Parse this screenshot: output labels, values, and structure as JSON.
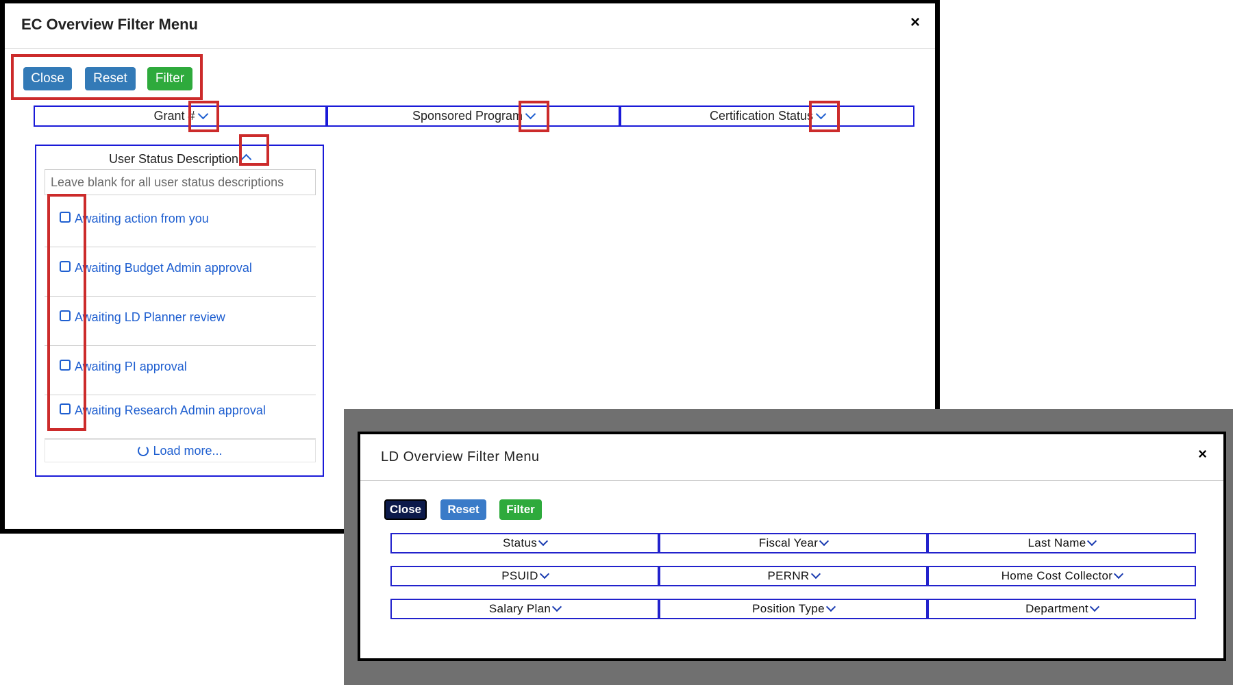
{
  "ec_dialog": {
    "title": "EC Overview Filter Menu",
    "close_x": "×",
    "buttons": {
      "close": "Close",
      "reset": "Reset",
      "filter": "Filter"
    },
    "columns": [
      "Grant #",
      "Sponsored Program",
      "Certification Status"
    ],
    "user_status": {
      "title": "User Status Description",
      "placeholder": "Leave blank for all user status descriptions",
      "items": [
        "Awaiting action from you",
        "Awaiting Budget Admin approval",
        "Awaiting LD Planner review",
        "Awaiting PI approval",
        "Awaiting Research Admin approval"
      ],
      "load_more": "Load more..."
    }
  },
  "ld_dialog": {
    "title": "LD Overview Filter Menu",
    "close_x": "×",
    "buttons": {
      "close": "Close",
      "reset": "Reset",
      "filter": "Filter"
    },
    "rows": [
      [
        "Status",
        "Fiscal Year",
        "Last Name"
      ],
      [
        "PSUID",
        "PERNR",
        "Home Cost Collector"
      ],
      [
        "Salary Plan",
        "Position Type",
        "Department"
      ]
    ]
  },
  "colors": {
    "primary_button": "#337ab7",
    "success_button": "#2eaa3c",
    "link_blue": "#1f5fd0",
    "column_border": "#1a1ad8",
    "highlight_red": "#cc2b2b",
    "overlay_gray": "#707070"
  }
}
